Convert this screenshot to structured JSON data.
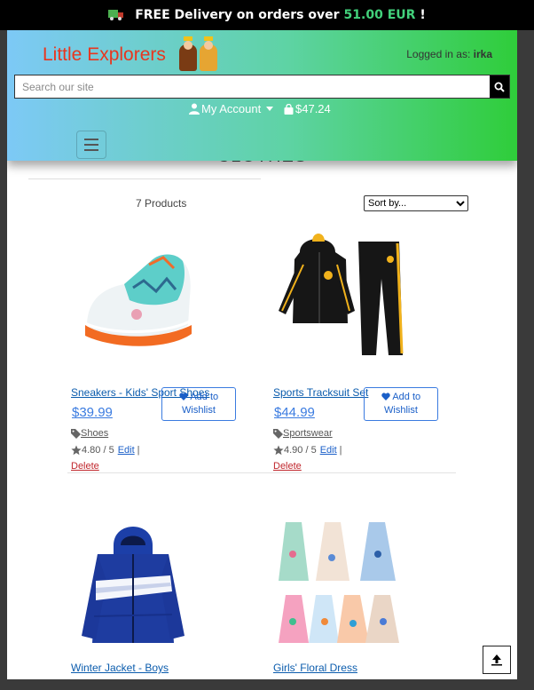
{
  "banner": {
    "free_text": "FREE Delivery on orders over",
    "amount": "51.00 EUR",
    "exclaim": "!"
  },
  "header": {
    "logo": "Little Explorers",
    "logged_in_label": "Logged in as:",
    "username": "irka",
    "search_placeholder": "Search our site",
    "account_label": "My Account",
    "cart_total": "$47.24"
  },
  "listing": {
    "section_title": "CLOTHES",
    "product_count": "7 Products",
    "sort_label": "Sort by..."
  },
  "products": [
    {
      "name": "Sneakers - Kids' Sport Shoes",
      "price": "$39.99",
      "wishlist_label": "Add to Wishlist",
      "category": "Shoes",
      "rating": "4.80 / 5",
      "edit_label": "Edit",
      "separator": "|",
      "delete_label": "Delete"
    },
    {
      "name": "Sports Tracksuit Set",
      "price": "$44.99",
      "wishlist_label": "Add to Wishlist",
      "category": "Sportswear",
      "rating": "4.90 / 5",
      "edit_label": "Edit",
      "separator": "|",
      "delete_label": "Delete"
    },
    {
      "name": "Winter Jacket - Boys"
    },
    {
      "name": "Girls' Floral Dress"
    }
  ],
  "colors": {
    "accent_green": "#42d17b",
    "logo_red": "#e8361f",
    "link_blue": "#1a5fc8",
    "delete_red": "#c0262c"
  }
}
